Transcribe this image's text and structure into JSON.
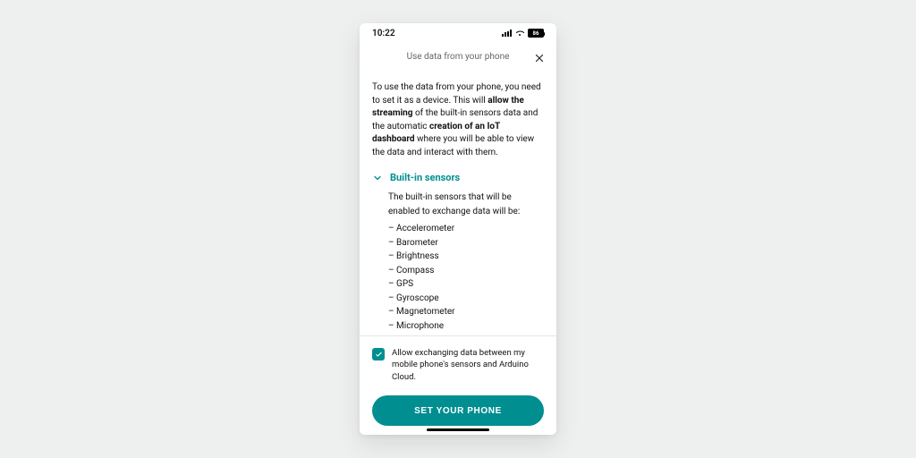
{
  "statusbar": {
    "time": "10:22",
    "battery": "86"
  },
  "header": {
    "title": "Use data from your phone"
  },
  "intro": {
    "t1": "To use the data from your phone, you need to set it as a device. This will ",
    "b1": "allow the streaming",
    "t2": " of the built-in sensors data and the automatic ",
    "b2": "creation of an IoT dashboard",
    "t3": " where you will be able to view the data and interact with them."
  },
  "section": {
    "title": "Built-in sensors",
    "lead": "The built-in sensors that will be enabled to exchange data will be:",
    "items": [
      "Accelerometer",
      "Barometer",
      "Brightness",
      "Compass",
      "GPS",
      "Gyroscope",
      "Magnetometer",
      "Microphone"
    ]
  },
  "consent": {
    "checked": true,
    "text": "Allow exchanging data between my mobile phone's sensors and Arduino Cloud."
  },
  "cta": {
    "label": "SET YOUR PHONE"
  },
  "colors": {
    "accent": "#008e91"
  }
}
